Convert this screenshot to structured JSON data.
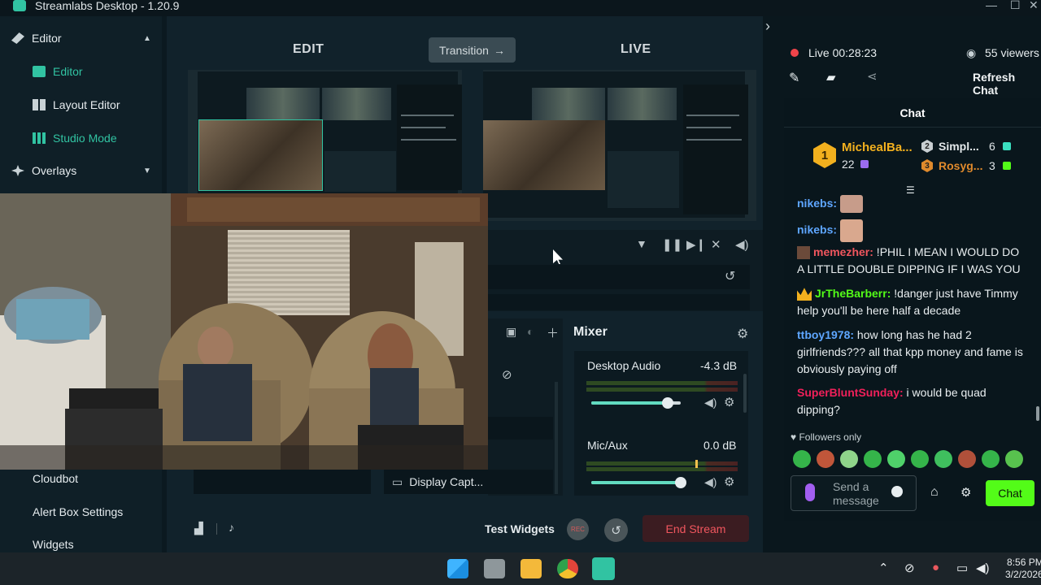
{
  "window": {
    "title": "Streamlabs Desktop - 1.20.9",
    "minimize": "—",
    "maximize": "☐",
    "close": "✕"
  },
  "sidebar": {
    "items": [
      {
        "label": "Editor",
        "chevron": "▲"
      },
      {
        "label": "Editor"
      },
      {
        "label": "Layout Editor"
      },
      {
        "label": "Studio Mode"
      },
      {
        "label": "Overlays",
        "chevron": "▼"
      },
      {
        "label": "Cloudbot"
      },
      {
        "label": "Alert Box Settings"
      },
      {
        "label": "Widgets"
      }
    ]
  },
  "editor": {
    "edit_label": "EDIT",
    "live_label": "LIVE",
    "transition_label": "Transition",
    "transition_arrow": "→"
  },
  "sources": {
    "display_capture": "Display Capt..."
  },
  "mixer": {
    "title": "Mixer",
    "channels": [
      {
        "name": "Desktop Audio",
        "level": "-4.3 dB",
        "volume": 0.85
      },
      {
        "name": "Mic/Aux",
        "level": "0.0 dB",
        "volume": 1.0
      }
    ]
  },
  "controls": {
    "test_widgets": "Test Widgets",
    "rec": "REC",
    "end_stream": "End Stream"
  },
  "stream": {
    "status": "Live",
    "time": "00:28:23",
    "viewers": "55 viewers",
    "refresh_chat": "Refresh Chat",
    "collapse": "›"
  },
  "chat": {
    "header": "Chat",
    "leaderboard": {
      "first": {
        "rank": "1",
        "name": "MichealBa...",
        "count": "22"
      },
      "second": {
        "rank": "2",
        "name": "Simpl...",
        "count": "6"
      },
      "third": {
        "rank": "3",
        "name": "Rosyg...",
        "count": "3"
      }
    },
    "messages": [
      {
        "user": "nikebs:",
        "text": ""
      },
      {
        "user": "nikebs:",
        "text": ""
      },
      {
        "user": "memezher:",
        "text": " !PHIL I MEAN I WOULD DO A LITTLE DOUBLE DIPPING IF I WAS YOU"
      },
      {
        "user": "JrTheBarberr:",
        "text": " !danger just have Timmy help you'll be here half a decade"
      },
      {
        "user": "ttboy1978:",
        "text": " how long has he had 2 girlfriends??? all that kpp money and fame is obviously paying off"
      },
      {
        "user": "SuperBluntSunday:",
        "text": " i would be quad dipping?"
      }
    ],
    "followers_only": "Followers only",
    "placeholder_line1": "Send a",
    "placeholder_line2": "message",
    "send_button": "Chat"
  },
  "taskbar": {
    "time": "8:56 PM",
    "date": "3/2/2026"
  },
  "colors": {
    "accent": "#31c3a2",
    "live_red": "#f0565e",
    "chat_green": "#53fc18"
  }
}
